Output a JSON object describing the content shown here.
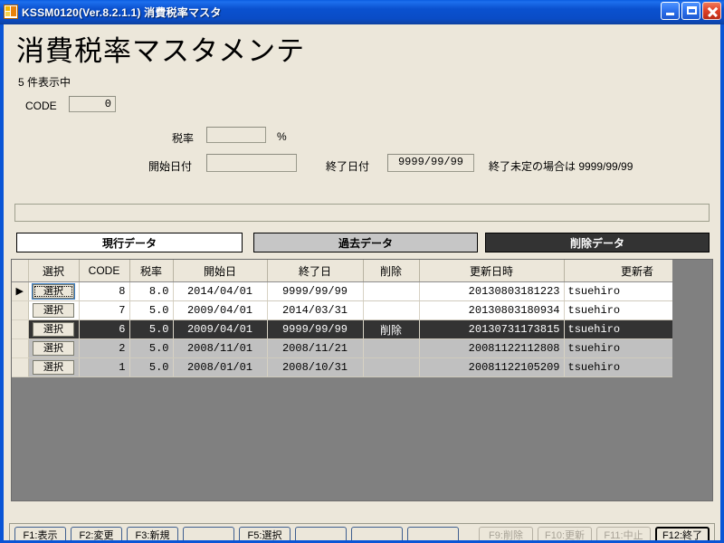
{
  "window": {
    "title": "KSSM0120(Ver.8.2.1.1) 消費税率マスタ",
    "icon": "app-icon",
    "controls": {
      "minimize": "minimize-icon",
      "maximize": "maximize-icon",
      "close": "close-icon"
    },
    "titlebar_color": "#0a51cf",
    "background_color": "#ece7da"
  },
  "header": {
    "page_title": "消費税率マスタメンテ",
    "record_count": "5 件表示中"
  },
  "form": {
    "code": {
      "label": "CODE",
      "value": "0"
    },
    "rate": {
      "label": "税率",
      "value": "",
      "suffix": "%"
    },
    "start_date": {
      "label": "開始日付",
      "value": "",
      "placeholder": ""
    },
    "end_date": {
      "label": "終了日付",
      "value": "9999/99/99"
    },
    "end_note": "終了未定の場合は 9999/99/99",
    "message_bar": ""
  },
  "tabs": [
    {
      "label": "現行データ",
      "state": "active",
      "bg": "#ffffff",
      "fg": "#000000"
    },
    {
      "label": "過去データ",
      "state": "inactive",
      "bg": "#c6c6c6",
      "fg": "#000000"
    },
    {
      "label": "削除データ",
      "state": "highlighted",
      "bg": "#333333",
      "fg": "#ffffff"
    }
  ],
  "grid": {
    "columns": [
      "選択",
      "CODE",
      "税率",
      "開始日",
      "終了日",
      "削除",
      "更新日時",
      "更新者"
    ],
    "select_button_label": "選択",
    "row_marker": "▶",
    "rows": [
      {
        "marker": "▶",
        "select": "選択",
        "code": "8",
        "rate": "8.0",
        "start": "2014/04/01",
        "end": "9999/99/99",
        "deleted": "",
        "updated_at": "20130803181223",
        "updated_by": "tsuehiro",
        "style": "row-white",
        "focused": true
      },
      {
        "marker": "",
        "select": "選択",
        "code": "7",
        "rate": "5.0",
        "start": "2009/04/01",
        "end": "2014/03/31",
        "deleted": "",
        "updated_at": "20130803180934",
        "updated_by": "tsuehiro",
        "style": "row-white",
        "focused": false
      },
      {
        "marker": "",
        "select": "選択",
        "code": "6",
        "rate": "5.0",
        "start": "2009/04/01",
        "end": "9999/99/99",
        "deleted": "削除",
        "updated_at": "20130731173815",
        "updated_by": "tsuehiro",
        "style": "row-dark",
        "focused": false
      },
      {
        "marker": "",
        "select": "選択",
        "code": "2",
        "rate": "5.0",
        "start": "2008/11/01",
        "end": "2008/11/21",
        "deleted": "",
        "updated_at": "20081122112808",
        "updated_by": "tsuehiro",
        "style": "row-gray",
        "focused": false
      },
      {
        "marker": "",
        "select": "選択",
        "code": "1",
        "rate": "5.0",
        "start": "2008/01/01",
        "end": "2008/10/31",
        "deleted": "",
        "updated_at": "20081122105209",
        "updated_by": "tsuehiro",
        "style": "row-gray",
        "focused": false
      }
    ]
  },
  "function_keys": [
    {
      "label": "F1:表示",
      "state": "enabled"
    },
    {
      "label": "F2:変更",
      "state": "enabled"
    },
    {
      "label": "F3:新規",
      "state": "enabled"
    },
    {
      "label": "",
      "state": "empty"
    },
    {
      "label": "F5:選択",
      "state": "enabled"
    },
    {
      "label": "",
      "state": "empty"
    },
    {
      "label": "",
      "state": "empty"
    },
    {
      "label": "",
      "state": "empty"
    },
    {
      "label": "F9:削除",
      "state": "disabled"
    },
    {
      "label": "F10:更新",
      "state": "disabled"
    },
    {
      "label": "F11:中止",
      "state": "disabled"
    },
    {
      "label": "F12:終了",
      "state": "primary"
    }
  ]
}
